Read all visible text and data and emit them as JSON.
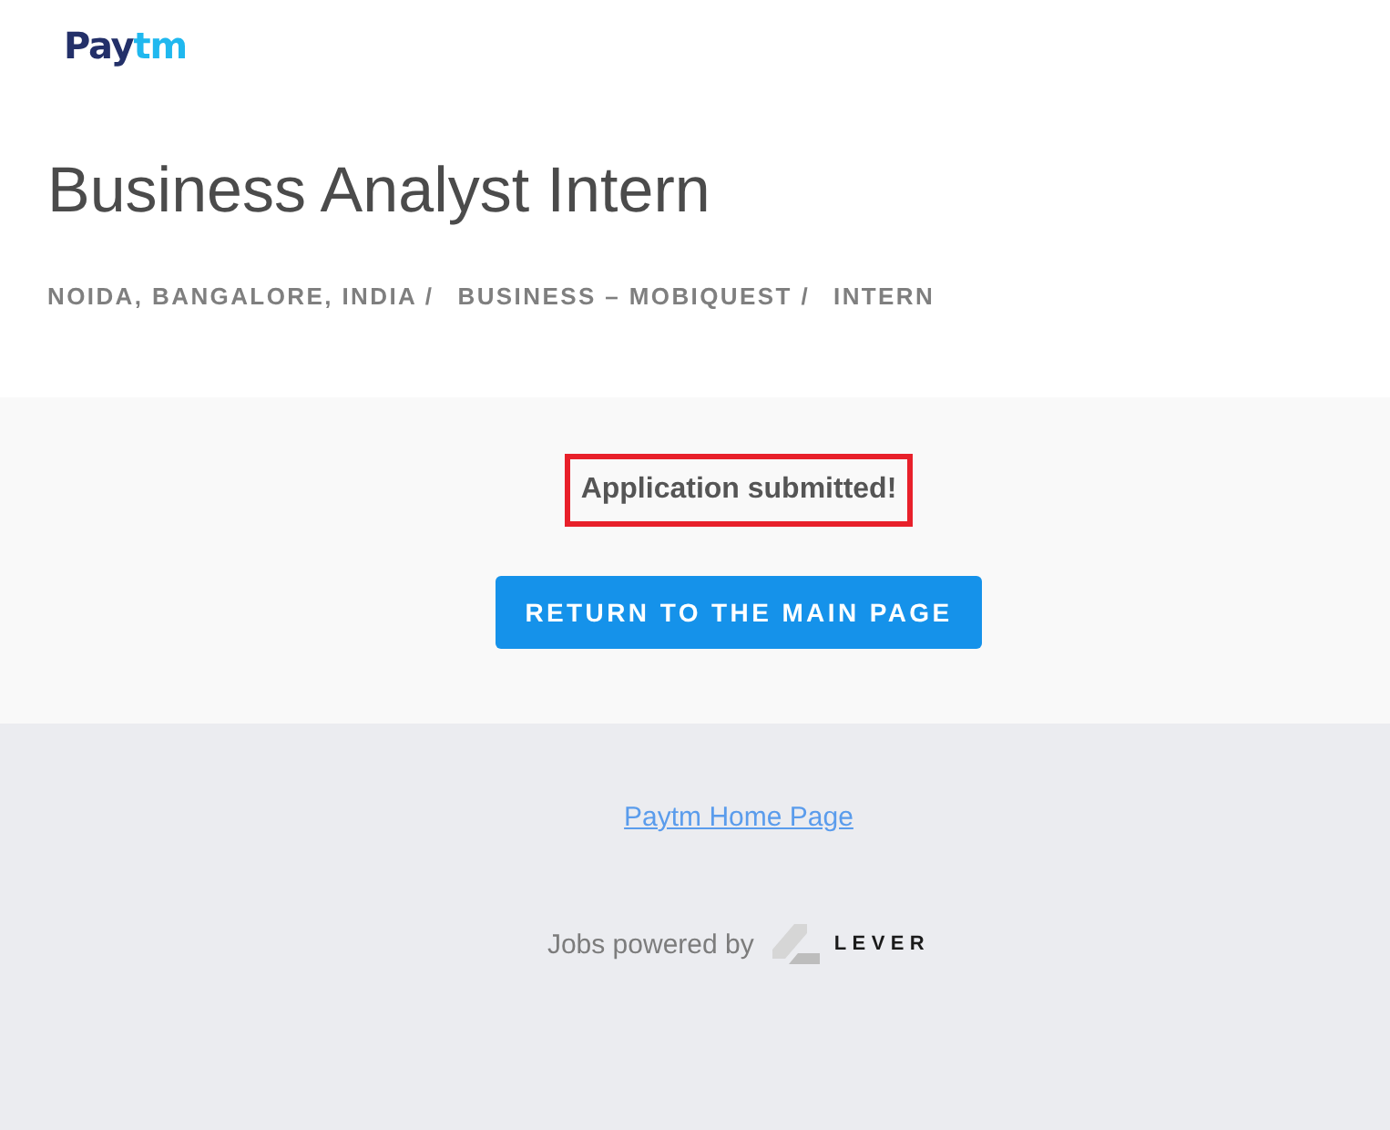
{
  "header": {
    "logo": {
      "segments": [
        {
          "text": "Pay",
          "color": "#233069"
        },
        {
          "text": "tm",
          "color": "#20b8ef"
        }
      ]
    },
    "title": "Business Analyst Intern",
    "categories": [
      "NOIDA, BANGALORE, INDIA /",
      "BUSINESS – MOBIQUEST /",
      "INTERN"
    ]
  },
  "status": {
    "message": "Application submitted!",
    "highlighted": true,
    "button": "RETURN TO THE MAIN PAGE"
  },
  "footer": {
    "link": "Paytm Home Page",
    "powered_by": "Jobs powered by",
    "brand": "LEVER"
  }
}
